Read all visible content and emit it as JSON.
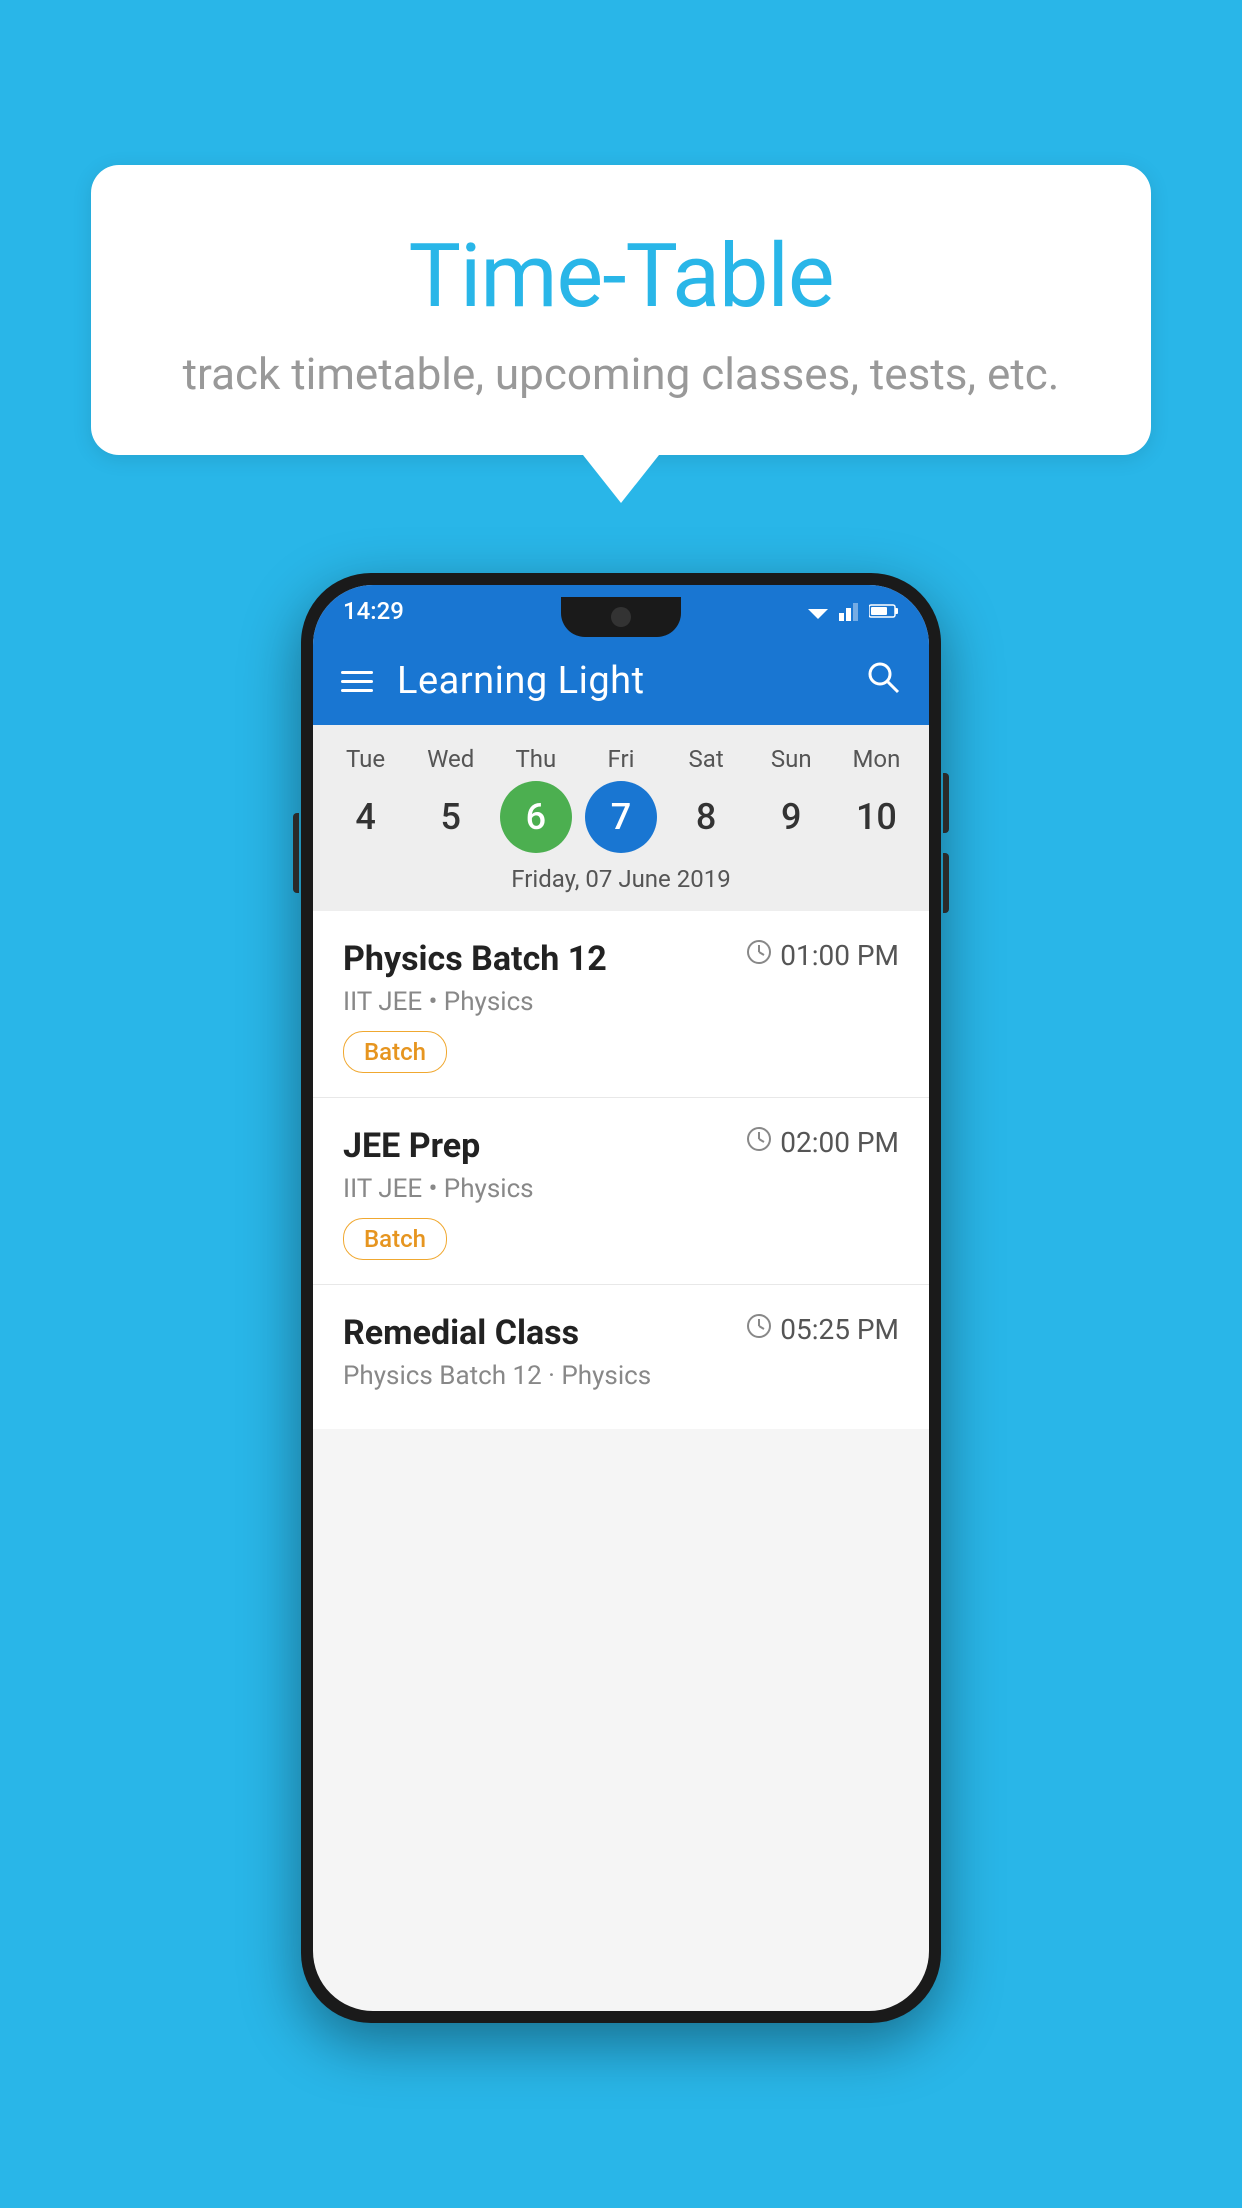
{
  "background_color": "#29B6E8",
  "speech_bubble": {
    "title": "Time-Table",
    "subtitle": "track timetable, upcoming classes, tests, etc."
  },
  "status_bar": {
    "time": "14:29",
    "icons": "▼▲▐"
  },
  "app_bar": {
    "title": "Learning Light",
    "menu_icon": "hamburger",
    "search_icon": "search"
  },
  "calendar": {
    "days": [
      "Tue",
      "Wed",
      "Thu",
      "Fri",
      "Sat",
      "Sun",
      "Mon"
    ],
    "dates": [
      "4",
      "5",
      "6",
      "7",
      "8",
      "9",
      "10"
    ],
    "today_index": 2,
    "selected_index": 3,
    "selected_date_label": "Friday, 07 June 2019"
  },
  "schedule": [
    {
      "title": "Physics Batch 12",
      "time": "01:00 PM",
      "subtitle": "IIT JEE • Physics",
      "badge": "Batch"
    },
    {
      "title": "JEE Prep",
      "time": "02:00 PM",
      "subtitle": "IIT JEE • Physics",
      "badge": "Batch"
    },
    {
      "title": "Remedial Class",
      "time": "05:25 PM",
      "subtitle": "Physics Batch 12 · Physics",
      "badge": ""
    }
  ]
}
